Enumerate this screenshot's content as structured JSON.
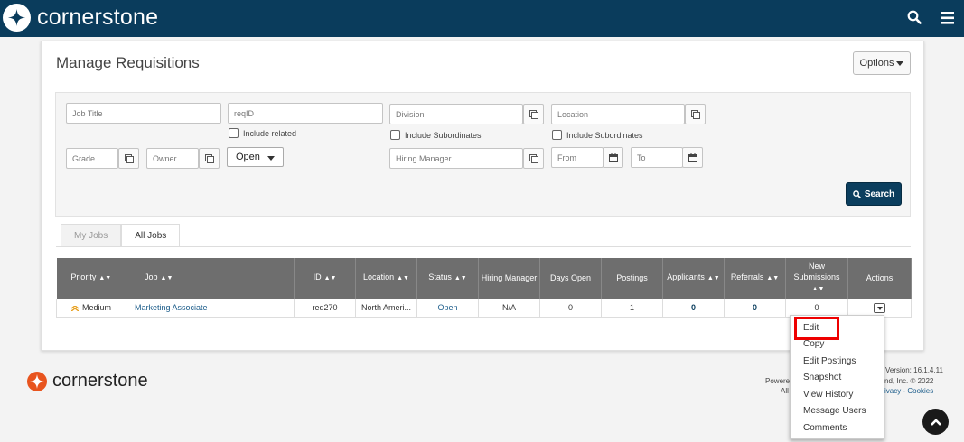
{
  "app": {
    "brand": "cornerstone"
  },
  "page": {
    "title": "Manage Requisitions",
    "options_label": "Options"
  },
  "filters": {
    "job_title": "Job Title",
    "req_id": "reqID",
    "division": "Division",
    "location": "Location",
    "include_related": "Include related",
    "include_subordinates_division": "Include Subordinates",
    "include_subordinates_location": "Include Subordinates",
    "grade": "Grade",
    "owner": "Owner",
    "status_value": "Open",
    "hiring_manager": "Hiring Manager",
    "from": "From",
    "to": "To",
    "search_label": "Search"
  },
  "tabs": [
    {
      "label": "My Jobs",
      "active": false
    },
    {
      "label": "All Jobs",
      "active": true
    }
  ],
  "table": {
    "headers": {
      "priority": "Priority",
      "job": "Job",
      "id": "ID",
      "location": "Location",
      "status": "Status",
      "hiring_manager": "Hiring Manager",
      "days_open": "Days Open",
      "postings": "Postings",
      "applicants": "Applicants",
      "referrals": "Referrals",
      "new_submissions": "New Submissions",
      "actions": "Actions"
    },
    "rows": [
      {
        "priority": "Medium",
        "job": "Marketing Associate",
        "id": "req270",
        "location": "North Ameri...",
        "status": "Open",
        "hiring_manager": "N/A",
        "days_open": "0",
        "postings": "1",
        "applicants": "0",
        "referrals": "0",
        "new_submissions": "0"
      }
    ]
  },
  "actions_menu": [
    "Edit",
    "Copy",
    "Edit Postings",
    "Snapshot",
    "View History",
    "Message Users",
    "Comments"
  ],
  "footer": {
    "brand": "cornerstone",
    "version": "Version: 16.1.4.11",
    "powered": "Powere",
    "copyright": "nd, Inc. © 2022",
    "all": "All",
    "privacy": "ivacy",
    "sep": " - ",
    "cookies": "Cookies"
  },
  "colors": {
    "header_bg": "#0a3c5c",
    "accent_orange": "#e8541e",
    "highlight_red": "#e00000"
  }
}
